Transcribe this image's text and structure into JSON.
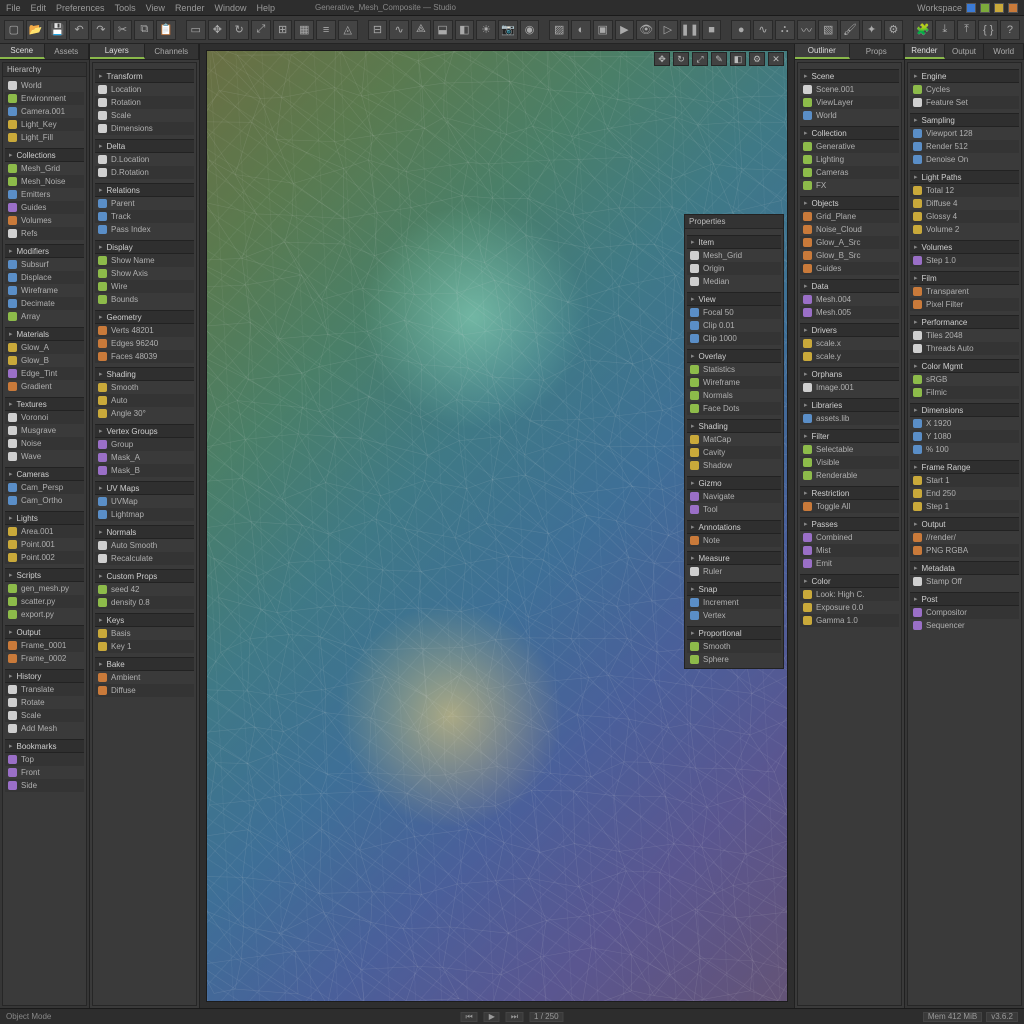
{
  "menubar": {
    "items": [
      "File",
      "Edit",
      "Preferences",
      "Tools",
      "View",
      "Render",
      "Window",
      "Help"
    ],
    "center_title": "Generative_Mesh_Composite — Studio",
    "right_label": "Workspace"
  },
  "toolbar": {
    "buttons": [
      "new",
      "open",
      "save",
      "undo",
      "redo",
      "cut",
      "copy",
      "paste",
      "select",
      "move",
      "rotate",
      "scale",
      "snap",
      "grid",
      "align",
      "mesh",
      "subdivide",
      "smooth",
      "decimate",
      "extrude",
      "bevel",
      "light",
      "camera",
      "material",
      "texture",
      "shade",
      "wire",
      "render",
      "preview",
      "play",
      "pause",
      "stop",
      "record",
      "graph",
      "nodes",
      "curves",
      "uv",
      "paint",
      "sculpt",
      "settings",
      "plugins",
      "export",
      "import",
      "script",
      "help"
    ]
  },
  "col1": {
    "tabs": [
      "Scene",
      "Assets"
    ],
    "top": {
      "header": "Hierarchy",
      "items": [
        {
          "i": "w",
          "t": "World"
        },
        {
          "i": "g",
          "t": "Environment"
        },
        {
          "i": "b",
          "t": "Camera.001"
        },
        {
          "i": "y",
          "t": "Light_Key"
        },
        {
          "i": "y",
          "t": "Light_Fill"
        }
      ]
    },
    "sections": [
      {
        "h": "Collections",
        "items": [
          {
            "i": "g",
            "t": "Mesh_Grid"
          },
          {
            "i": "g",
            "t": "Mesh_Noise"
          },
          {
            "i": "b",
            "t": "Emitters"
          },
          {
            "i": "p",
            "t": "Guides"
          },
          {
            "i": "o",
            "t": "Volumes"
          },
          {
            "i": "w",
            "t": "Refs"
          }
        ]
      },
      {
        "h": "Modifiers",
        "items": [
          {
            "i": "b",
            "t": "Subsurf"
          },
          {
            "i": "b",
            "t": "Displace"
          },
          {
            "i": "b",
            "t": "Wireframe"
          },
          {
            "i": "b",
            "t": "Decimate"
          },
          {
            "i": "g",
            "t": "Array"
          }
        ]
      },
      {
        "h": "Materials",
        "items": [
          {
            "i": "y",
            "t": "Glow_A"
          },
          {
            "i": "y",
            "t": "Glow_B"
          },
          {
            "i": "p",
            "t": "Edge_Tint"
          },
          {
            "i": "o",
            "t": "Gradient"
          }
        ]
      },
      {
        "h": "Textures",
        "items": [
          {
            "i": "w",
            "t": "Voronoi"
          },
          {
            "i": "w",
            "t": "Musgrave"
          },
          {
            "i": "w",
            "t": "Noise"
          },
          {
            "i": "w",
            "t": "Wave"
          }
        ]
      },
      {
        "h": "Cameras",
        "items": [
          {
            "i": "b",
            "t": "Cam_Persp"
          },
          {
            "i": "b",
            "t": "Cam_Ortho"
          }
        ]
      },
      {
        "h": "Lights",
        "items": [
          {
            "i": "y",
            "t": "Area.001"
          },
          {
            "i": "y",
            "t": "Point.001"
          },
          {
            "i": "y",
            "t": "Point.002"
          }
        ]
      },
      {
        "h": "Scripts",
        "items": [
          {
            "i": "g",
            "t": "gen_mesh.py"
          },
          {
            "i": "g",
            "t": "scatter.py"
          },
          {
            "i": "g",
            "t": "export.py"
          }
        ]
      },
      {
        "h": "Output",
        "items": [
          {
            "i": "o",
            "t": "Frame_0001"
          },
          {
            "i": "o",
            "t": "Frame_0002"
          }
        ]
      },
      {
        "h": "History",
        "items": [
          {
            "i": "w",
            "t": "Translate"
          },
          {
            "i": "w",
            "t": "Rotate"
          },
          {
            "i": "w",
            "t": "Scale"
          },
          {
            "i": "w",
            "t": "Add Mesh"
          }
        ]
      },
      {
        "h": "Bookmarks",
        "items": [
          {
            "i": "p",
            "t": "Top"
          },
          {
            "i": "p",
            "t": "Front"
          },
          {
            "i": "p",
            "t": "Side"
          }
        ]
      }
    ]
  },
  "col2": {
    "tabs": [
      "Layers",
      "Channels"
    ],
    "sections": [
      {
        "h": "Transform",
        "items": [
          {
            "i": "w",
            "t": "Location"
          },
          {
            "i": "w",
            "t": "Rotation"
          },
          {
            "i": "w",
            "t": "Scale"
          },
          {
            "i": "w",
            "t": "Dimensions"
          }
        ]
      },
      {
        "h": "Delta",
        "items": [
          {
            "i": "w",
            "t": "D.Location"
          },
          {
            "i": "w",
            "t": "D.Rotation"
          }
        ]
      },
      {
        "h": "Relations",
        "items": [
          {
            "i": "b",
            "t": "Parent"
          },
          {
            "i": "b",
            "t": "Track"
          },
          {
            "i": "b",
            "t": "Pass Index"
          }
        ]
      },
      {
        "h": "Display",
        "items": [
          {
            "i": "g",
            "t": "Show Name"
          },
          {
            "i": "g",
            "t": "Show Axis"
          },
          {
            "i": "g",
            "t": "Wire"
          },
          {
            "i": "g",
            "t": "Bounds"
          }
        ]
      },
      {
        "h": "Geometry",
        "items": [
          {
            "i": "o",
            "t": "Verts 48201"
          },
          {
            "i": "o",
            "t": "Edges 96240"
          },
          {
            "i": "o",
            "t": "Faces 48039"
          }
        ]
      },
      {
        "h": "Shading",
        "items": [
          {
            "i": "y",
            "t": "Smooth"
          },
          {
            "i": "y",
            "t": "Auto"
          },
          {
            "i": "y",
            "t": "Angle 30°"
          }
        ]
      },
      {
        "h": "Vertex Groups",
        "items": [
          {
            "i": "p",
            "t": "Group"
          },
          {
            "i": "p",
            "t": "Mask_A"
          },
          {
            "i": "p",
            "t": "Mask_B"
          }
        ]
      },
      {
        "h": "UV Maps",
        "items": [
          {
            "i": "b",
            "t": "UVMap"
          },
          {
            "i": "b",
            "t": "Lightmap"
          }
        ]
      },
      {
        "h": "Normals",
        "items": [
          {
            "i": "w",
            "t": "Auto Smooth"
          },
          {
            "i": "w",
            "t": "Recalculate"
          }
        ]
      },
      {
        "h": "Custom Props",
        "items": [
          {
            "i": "g",
            "t": "seed  42"
          },
          {
            "i": "g",
            "t": "density 0.8"
          }
        ]
      },
      {
        "h": "Keys",
        "items": [
          {
            "i": "y",
            "t": "Basis"
          },
          {
            "i": "y",
            "t": "Key 1"
          }
        ]
      },
      {
        "h": "Bake",
        "items": [
          {
            "i": "o",
            "t": "Ambient"
          },
          {
            "i": "o",
            "t": "Diffuse"
          }
        ]
      }
    ]
  },
  "dock": {
    "buttons": [
      "✥",
      "↻",
      "⤢",
      "✎",
      "◧",
      "⚙",
      "✕"
    ]
  },
  "float_panel": {
    "header": "Properties",
    "sections": [
      {
        "h": "Item",
        "items": [
          {
            "i": "w",
            "t": "Mesh_Grid"
          },
          {
            "i": "w",
            "t": "Origin"
          },
          {
            "i": "w",
            "t": "Median"
          }
        ]
      },
      {
        "h": "View",
        "items": [
          {
            "i": "b",
            "t": "Focal 50"
          },
          {
            "i": "b",
            "t": "Clip 0.01"
          },
          {
            "i": "b",
            "t": "Clip 1000"
          }
        ]
      },
      {
        "h": "Overlay",
        "items": [
          {
            "i": "g",
            "t": "Statistics"
          },
          {
            "i": "g",
            "t": "Wireframe"
          },
          {
            "i": "g",
            "t": "Normals"
          },
          {
            "i": "g",
            "t": "Face Dots"
          }
        ]
      },
      {
        "h": "Shading",
        "items": [
          {
            "i": "y",
            "t": "MatCap"
          },
          {
            "i": "y",
            "t": "Cavity"
          },
          {
            "i": "y",
            "t": "Shadow"
          }
        ]
      },
      {
        "h": "Gizmo",
        "items": [
          {
            "i": "p",
            "t": "Navigate"
          },
          {
            "i": "p",
            "t": "Tool"
          }
        ]
      },
      {
        "h": "Annotations",
        "items": [
          {
            "i": "o",
            "t": "Note"
          }
        ]
      },
      {
        "h": "Measure",
        "items": [
          {
            "i": "w",
            "t": "Ruler"
          }
        ]
      },
      {
        "h": "Snap",
        "items": [
          {
            "i": "b",
            "t": "Increment"
          },
          {
            "i": "b",
            "t": "Vertex"
          }
        ]
      },
      {
        "h": "Proportional",
        "items": [
          {
            "i": "g",
            "t": "Smooth"
          },
          {
            "i": "g",
            "t": "Sphere"
          }
        ]
      }
    ]
  },
  "col4": {
    "tabs": [
      "Outliner",
      "Props"
    ],
    "sections": [
      {
        "h": "Scene",
        "items": [
          {
            "i": "w",
            "t": "Scene.001"
          },
          {
            "i": "g",
            "t": "ViewLayer"
          },
          {
            "i": "b",
            "t": "World"
          }
        ]
      },
      {
        "h": "Collection",
        "items": [
          {
            "i": "g",
            "t": "Generative"
          },
          {
            "i": "g",
            "t": "Lighting"
          },
          {
            "i": "g",
            "t": "Cameras"
          },
          {
            "i": "g",
            "t": "FX"
          }
        ]
      },
      {
        "h": "Objects",
        "items": [
          {
            "i": "o",
            "t": "Grid_Plane"
          },
          {
            "i": "o",
            "t": "Noise_Cloud"
          },
          {
            "i": "o",
            "t": "Glow_A_Src"
          },
          {
            "i": "o",
            "t": "Glow_B_Src"
          },
          {
            "i": "o",
            "t": "Guides"
          }
        ]
      },
      {
        "h": "Data",
        "items": [
          {
            "i": "p",
            "t": "Mesh.004"
          },
          {
            "i": "p",
            "t": "Mesh.005"
          }
        ]
      },
      {
        "h": "Drivers",
        "items": [
          {
            "i": "y",
            "t": "scale.x"
          },
          {
            "i": "y",
            "t": "scale.y"
          }
        ]
      },
      {
        "h": "Orphans",
        "items": [
          {
            "i": "w",
            "t": "Image.001"
          }
        ]
      },
      {
        "h": "Libraries",
        "items": [
          {
            "i": "b",
            "t": "assets.lib"
          }
        ]
      },
      {
        "h": "Filter",
        "items": [
          {
            "i": "g",
            "t": "Selectable"
          },
          {
            "i": "g",
            "t": "Visible"
          },
          {
            "i": "g",
            "t": "Renderable"
          }
        ]
      },
      {
        "h": "Restriction",
        "items": [
          {
            "i": "o",
            "t": "Toggle All"
          }
        ]
      },
      {
        "h": "Passes",
        "items": [
          {
            "i": "p",
            "t": "Combined"
          },
          {
            "i": "p",
            "t": "Mist"
          },
          {
            "i": "p",
            "t": "Emit"
          }
        ]
      },
      {
        "h": "Color",
        "items": [
          {
            "i": "y",
            "t": "Look: High C."
          },
          {
            "i": "y",
            "t": "Exposure 0.0"
          },
          {
            "i": "y",
            "t": "Gamma 1.0"
          }
        ]
      }
    ]
  },
  "col5": {
    "tabs": [
      "Render",
      "Output",
      "World"
    ],
    "sections": [
      {
        "h": "Engine",
        "items": [
          {
            "i": "g",
            "t": "Cycles"
          },
          {
            "i": "w",
            "t": "Feature Set"
          }
        ]
      },
      {
        "h": "Sampling",
        "items": [
          {
            "i": "b",
            "t": "Viewport 128"
          },
          {
            "i": "b",
            "t": "Render 512"
          },
          {
            "i": "b",
            "t": "Denoise On"
          }
        ]
      },
      {
        "h": "Light Paths",
        "items": [
          {
            "i": "y",
            "t": "Total 12"
          },
          {
            "i": "y",
            "t": "Diffuse 4"
          },
          {
            "i": "y",
            "t": "Glossy 4"
          },
          {
            "i": "y",
            "t": "Volume 2"
          }
        ]
      },
      {
        "h": "Volumes",
        "items": [
          {
            "i": "p",
            "t": "Step 1.0"
          }
        ]
      },
      {
        "h": "Film",
        "items": [
          {
            "i": "o",
            "t": "Transparent"
          },
          {
            "i": "o",
            "t": "Pixel Filter"
          }
        ]
      },
      {
        "h": "Performance",
        "items": [
          {
            "i": "w",
            "t": "Tiles 2048"
          },
          {
            "i": "w",
            "t": "Threads Auto"
          }
        ]
      },
      {
        "h": "Color Mgmt",
        "items": [
          {
            "i": "g",
            "t": "sRGB"
          },
          {
            "i": "g",
            "t": "Filmic"
          }
        ]
      },
      {
        "h": "Dimensions",
        "items": [
          {
            "i": "b",
            "t": "X 1920"
          },
          {
            "i": "b",
            "t": "Y 1080"
          },
          {
            "i": "b",
            "t": "% 100"
          }
        ]
      },
      {
        "h": "Frame Range",
        "items": [
          {
            "i": "y",
            "t": "Start 1"
          },
          {
            "i": "y",
            "t": "End 250"
          },
          {
            "i": "y",
            "t": "Step 1"
          }
        ]
      },
      {
        "h": "Output",
        "items": [
          {
            "i": "o",
            "t": "//render/"
          },
          {
            "i": "o",
            "t": "PNG RGBA"
          }
        ]
      },
      {
        "h": "Metadata",
        "items": [
          {
            "i": "w",
            "t": "Stamp Off"
          }
        ]
      },
      {
        "h": "Post",
        "items": [
          {
            "i": "p",
            "t": "Compositor"
          },
          {
            "i": "p",
            "t": "Sequencer"
          }
        ]
      }
    ]
  },
  "statusbar": {
    "left": "Object Mode",
    "center": [
      "⏮",
      "▶",
      "⏭",
      "1 / 250"
    ],
    "right": [
      "Mem 412 MiB",
      "v3.6.2"
    ]
  }
}
